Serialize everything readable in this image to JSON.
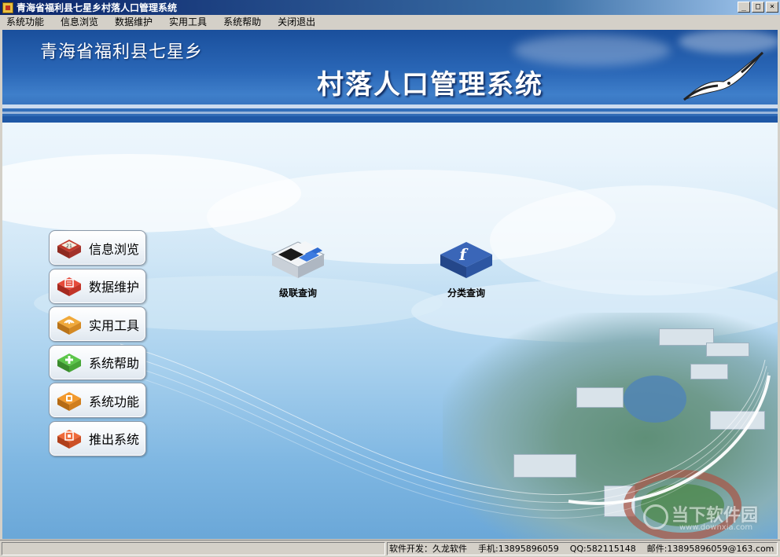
{
  "window": {
    "title": "青海省福利县七星乡村落人口管理系统",
    "controls": {
      "minimize": "_",
      "maximize": "□",
      "close": "×"
    }
  },
  "menu": {
    "items": [
      "系统功能",
      "信息浏览",
      "数据维护",
      "实用工具",
      "系统帮助",
      "关闭退出"
    ]
  },
  "banner": {
    "subtitle": "青海省福利县七星乡",
    "title": "村落人口管理系统"
  },
  "nav": {
    "items": [
      {
        "label": "信息浏览",
        "icon": "calendar-icon",
        "color": "#c0392b"
      },
      {
        "label": "数据维护",
        "icon": "database-icon",
        "color": "#d9342b"
      },
      {
        "label": "实用工具",
        "icon": "rss-icon",
        "color": "#e0962a"
      },
      {
        "label": "系统帮助",
        "icon": "add-icon",
        "color": "#4caf3c"
      },
      {
        "label": "系统功能",
        "icon": "settings-icon",
        "color": "#e88a1f"
      },
      {
        "label": "推出系统",
        "icon": "exit-icon",
        "color": "#e0582a"
      }
    ]
  },
  "shortcuts": [
    {
      "label": "级联查询",
      "icon": "cascade-query-icon"
    },
    {
      "label": "分类查询",
      "icon": "category-query-icon"
    }
  ],
  "watermark": {
    "text": "当下软件园",
    "url": "www.downxia.com"
  },
  "status": {
    "developer": "软件开发：久龙软件",
    "phone": "手机:13895896059",
    "qq": "QQ:582115148",
    "email": "邮件:13895896059@163.com"
  }
}
